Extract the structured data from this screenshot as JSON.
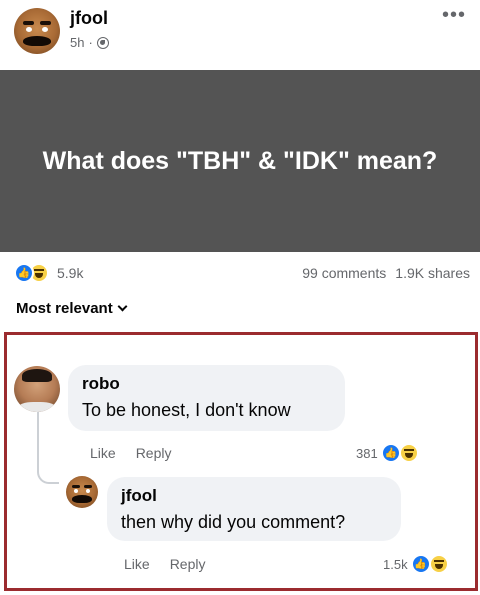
{
  "post": {
    "author": "jfool",
    "time": "5h",
    "more_icon": "•••",
    "banner_text": "What does \"TBH\" & \"IDK\" mean?",
    "reaction_count": "5.9k",
    "comments": "99 comments",
    "shares": "1.9K shares",
    "sort_label": "Most relevant"
  },
  "comments": [
    {
      "author": "robo",
      "text": "To be honest, I don't know",
      "like": "Like",
      "reply": "Reply",
      "reaction_count": "381"
    },
    {
      "author": "jfool",
      "text": "then why did you comment?",
      "like": "Like",
      "reply": "Reply",
      "reaction_count": "1.5k"
    }
  ],
  "colors": {
    "banner_bg": "#545454",
    "highlight_border": "#9b2b2f",
    "like_blue": "#1877f2",
    "haha_yellow": "#f7d046"
  }
}
